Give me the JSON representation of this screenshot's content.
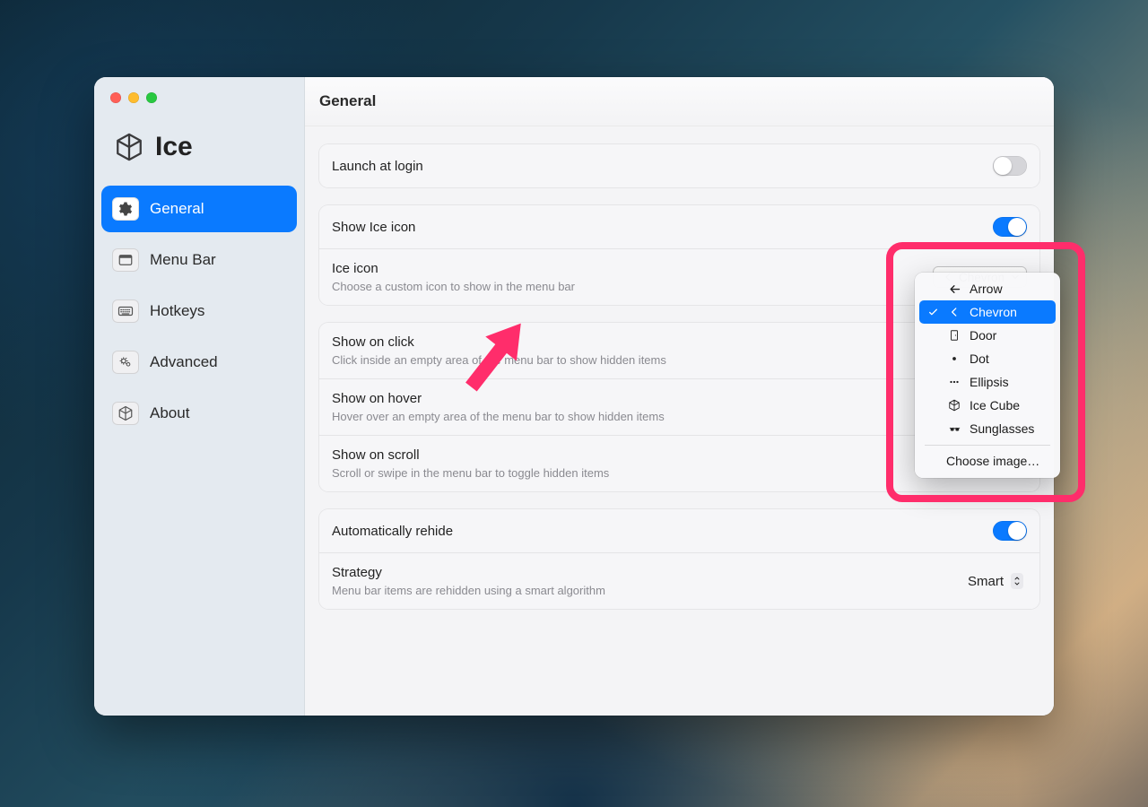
{
  "app_name": "Ice",
  "header_title": "General",
  "sidebar": {
    "items": [
      {
        "id": "general",
        "label": "General",
        "icon": "gear-icon",
        "active": true
      },
      {
        "id": "menubar",
        "label": "Menu Bar",
        "icon": "menubar-icon",
        "active": false
      },
      {
        "id": "hotkeys",
        "label": "Hotkeys",
        "icon": "keyboard-icon",
        "active": false
      },
      {
        "id": "advanced",
        "label": "Advanced",
        "icon": "gears-icon",
        "active": false
      },
      {
        "id": "about",
        "label": "About",
        "icon": "cube-icon",
        "active": false
      }
    ]
  },
  "settings": {
    "launch_at_login": {
      "title": "Launch at login",
      "on": false
    },
    "show_ice_icon": {
      "title": "Show Ice icon",
      "on": true
    },
    "ice_icon": {
      "title": "Ice icon",
      "subtitle": "Choose a custom icon to show in the menu bar",
      "value": "Chevron"
    },
    "show_on_click": {
      "title": "Show on click",
      "subtitle": "Click inside an empty area of the menu bar to show hidden items"
    },
    "show_on_hover": {
      "title": "Show on hover",
      "subtitle": "Hover over an empty area of the menu bar to show hidden items"
    },
    "show_on_scroll": {
      "title": "Show on scroll",
      "subtitle": "Scroll or swipe in the menu bar to toggle hidden items"
    },
    "auto_rehide": {
      "title": "Automatically rehide",
      "on": true
    },
    "strategy": {
      "title": "Strategy",
      "subtitle": "Menu bar items are rehidden using a smart algorithm",
      "value": "Smart"
    }
  },
  "icon_menu": {
    "options": [
      {
        "label": "Arrow",
        "icon": "arrow-left-icon"
      },
      {
        "label": "Chevron",
        "icon": "chevron-left-icon",
        "selected": true
      },
      {
        "label": "Door",
        "icon": "door-icon"
      },
      {
        "label": "Dot",
        "icon": "dot-icon"
      },
      {
        "label": "Ellipsis",
        "icon": "ellipsis-icon"
      },
      {
        "label": "Ice Cube",
        "icon": "cube-icon"
      },
      {
        "label": "Sunglasses",
        "icon": "sunglasses-icon"
      }
    ],
    "choose_image_label": "Choose image…"
  },
  "colors": {
    "accent": "#0a7aff",
    "annotation": "#ff2d6b"
  }
}
